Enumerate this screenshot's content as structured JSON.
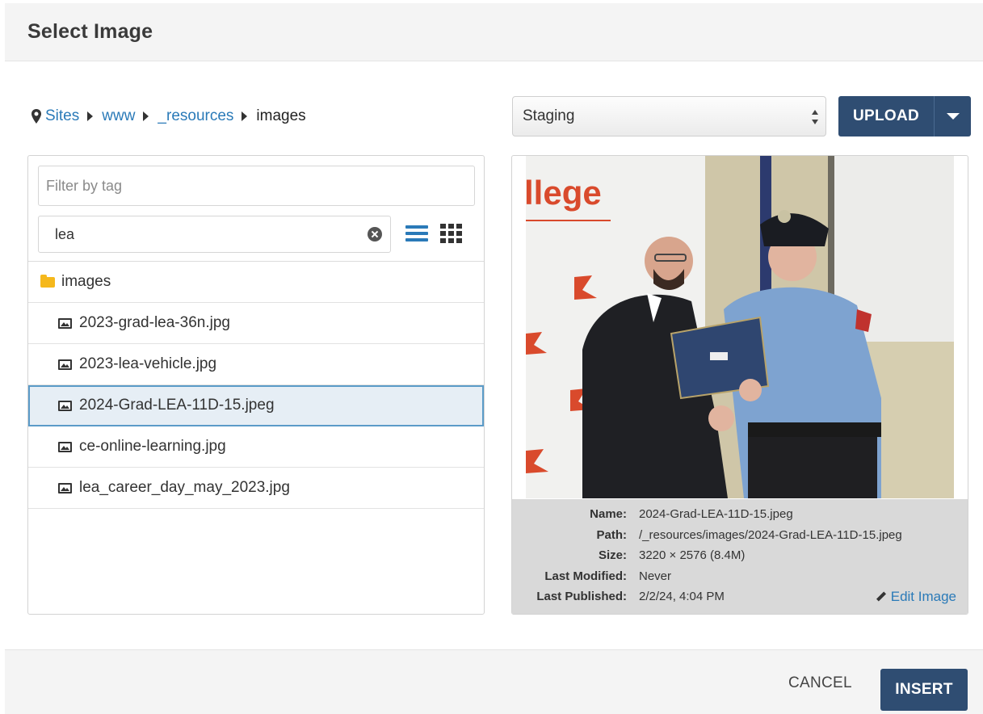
{
  "dialog": {
    "title": "Select Image"
  },
  "breadcrumb": {
    "items": [
      {
        "label": "Sites"
      },
      {
        "label": "www"
      },
      {
        "label": "_resources"
      },
      {
        "label": "images"
      }
    ]
  },
  "filters": {
    "tag_placeholder": "Filter by tag",
    "tag_value": "",
    "search_value": "lea"
  },
  "file_list": {
    "folder": "images",
    "files": [
      {
        "name": "2023-grad-lea-36n.jpg",
        "selected": false
      },
      {
        "name": "2023-lea-vehicle.jpg",
        "selected": false
      },
      {
        "name": "2024-Grad-LEA-11D-15.jpeg",
        "selected": true
      },
      {
        "name": "ce-online-learning.jpg",
        "selected": false
      },
      {
        "name": "lea_career_day_may_2023.jpg",
        "selected": false
      }
    ]
  },
  "environment": {
    "selected": "Staging"
  },
  "upload": {
    "label": "UPLOAD"
  },
  "preview": {
    "photo_text": "llege",
    "details": [
      {
        "label": "Name:",
        "value": "2024-Grad-LEA-11D-15.jpeg"
      },
      {
        "label": "Path:",
        "value": "/_resources/images/2024-Grad-LEA-11D-15.jpeg"
      },
      {
        "label": "Size:",
        "value": "3220 × 2576 (8.4M)"
      },
      {
        "label": "Last Modified:",
        "value": "Never"
      },
      {
        "label": "Last Published:",
        "value": "2/2/24, 4:04 PM"
      }
    ],
    "edit_label": "Edit Image"
  },
  "footer": {
    "cancel_label": "CANCEL",
    "insert_label": "INSERT"
  },
  "colors": {
    "primary": "#2f4d72",
    "link": "#2a7ab8",
    "folder": "#f5b81c",
    "selected_border": "#5b9bc8"
  },
  "icons": [
    "map-pin-icon",
    "caret-right-icon",
    "clear-icon",
    "list-view-icon",
    "grid-view-icon",
    "folder-icon",
    "image-file-icon",
    "select-arrows-icon",
    "caret-down-icon",
    "pencil-icon"
  ]
}
